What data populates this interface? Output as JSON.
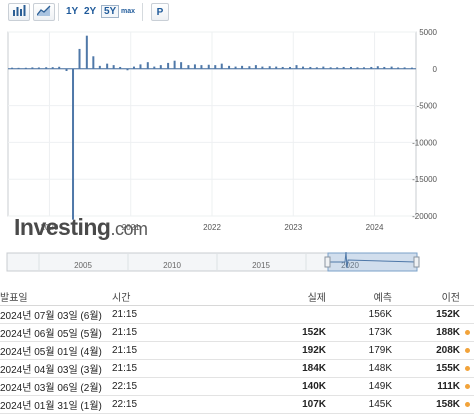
{
  "toolbar": {
    "icons": [
      "bar-chart-icon",
      "line-chart-icon"
    ],
    "ranges": [
      "1Y",
      "2Y",
      "5Y",
      "max"
    ],
    "active_range": "5Y",
    "print_label": "P"
  },
  "logo": {
    "brand": "Investing",
    "suffix": ".com"
  },
  "colors": {
    "bar": "#4f78a8",
    "positive": "#1a9be0",
    "negative": "#e02020",
    "revised": "#f2a33a"
  },
  "chart_data": {
    "type": "bar",
    "title": "",
    "xlabel": "",
    "ylabel": "",
    "ylim": [
      -2000,
      5000
    ],
    "y_ticks": [
      5000,
      0,
      -5000,
      -10000,
      -15000,
      -20000
    ],
    "y_tick_labels": [
      "5000",
      "0",
      "-5000",
      "-10000",
      "-15000",
      "-20000"
    ],
    "x_ticks": [
      2020,
      2021,
      2022,
      2023,
      2024
    ],
    "x_tick_labels": [
      "2020",
      "2021",
      "2022",
      "2023",
      "2024"
    ],
    "grid": true,
    "x": [
      2019.54,
      2019.62,
      2019.71,
      2019.79,
      2019.87,
      2019.96,
      2020.04,
      2020.12,
      2020.21,
      2020.29,
      2020.37,
      2020.46,
      2020.54,
      2020.62,
      2020.71,
      2020.79,
      2020.87,
      2020.96,
      2021.04,
      2021.12,
      2021.21,
      2021.29,
      2021.37,
      2021.46,
      2021.54,
      2021.62,
      2021.71,
      2021.79,
      2021.87,
      2021.96,
      2022.04,
      2022.12,
      2022.21,
      2022.29,
      2022.37,
      2022.46,
      2022.54,
      2022.62,
      2022.71,
      2022.79,
      2022.87,
      2022.96,
      2023.04,
      2023.12,
      2023.21,
      2023.29,
      2023.37,
      2023.46,
      2023.54,
      2023.62,
      2023.71,
      2023.79,
      2023.87,
      2023.96,
      2024.04,
      2024.12,
      2024.21,
      2024.29,
      2024.37,
      2024.46
    ],
    "values": [
      150,
      130,
      140,
      190,
      180,
      210,
      220,
      275,
      -300,
      -20500,
      2700,
      4500,
      1700,
      400,
      700,
      500,
      250,
      -200,
      300,
      600,
      900,
      300,
      500,
      800,
      1100,
      900,
      500,
      600,
      500,
      550,
      500,
      700,
      400,
      300,
      400,
      350,
      500,
      300,
      350,
      300,
      250,
      250,
      500,
      300,
      250,
      200,
      300,
      200,
      200,
      250,
      250,
      200,
      200,
      250,
      350,
      250,
      300,
      180,
      190,
      160
    ]
  },
  "navigator": {
    "labels": [
      "2005",
      "2010",
      "2015",
      "2020"
    ]
  },
  "table": {
    "headers": {
      "date": "발표일",
      "time": "시간",
      "actual": "실제",
      "forecast": "예측",
      "previous": "이전"
    },
    "rows": [
      {
        "date": "2024년 07월 03일 (6월)",
        "time": "21:15",
        "actual": "",
        "actual_color": "",
        "forecast": "156K",
        "previous": "152K",
        "previous_color": "",
        "revised": false
      },
      {
        "date": "2024년 06월 05일 (5월)",
        "time": "21:15",
        "actual": "152K",
        "actual_color": "green",
        "forecast": "173K",
        "previous": "188K",
        "previous_color": "green",
        "revised": true
      },
      {
        "date": "2024년 05월 01일 (4월)",
        "time": "21:15",
        "actual": "192K",
        "actual_color": "red",
        "forecast": "179K",
        "previous": "208K",
        "previous_color": "red",
        "revised": true
      },
      {
        "date": "2024년 04월 03일 (3월)",
        "time": "21:15",
        "actual": "184K",
        "actual_color": "red",
        "forecast": "148K",
        "previous": "155K",
        "previous_color": "red",
        "revised": true
      },
      {
        "date": "2024년 03월 06일 (2월)",
        "time": "22:15",
        "actual": "140K",
        "actual_color": "green",
        "forecast": "149K",
        "previous": "111K",
        "previous_color": "red",
        "revised": true
      },
      {
        "date": "2024년 01월 31일 (1월)",
        "time": "22:15",
        "actual": "107K",
        "actual_color": "green",
        "forecast": "145K",
        "previous": "158K",
        "previous_color": "green",
        "revised": true
      }
    ]
  }
}
